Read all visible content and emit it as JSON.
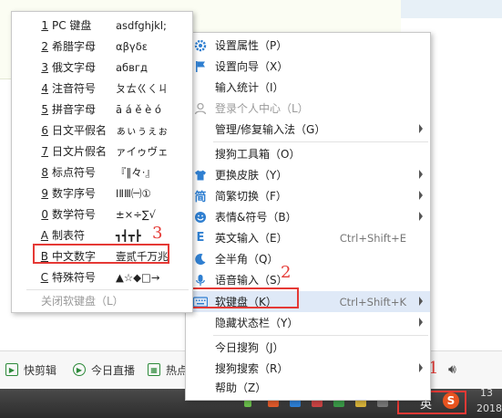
{
  "soft_keyboard_menu": {
    "items": [
      {
        "num": "1",
        "name": "PC 键盘",
        "sample": "asdfghjkl;"
      },
      {
        "num": "2",
        "name": "希腊字母",
        "sample": "αβγδε"
      },
      {
        "num": "3",
        "name": "俄文字母",
        "sample": "абвгд"
      },
      {
        "num": "4",
        "name": "注音符号",
        "sample": "ㄆㄊㄍㄑㄐ"
      },
      {
        "num": "5",
        "name": "拼音字母",
        "sample": "ā á ě è ó"
      },
      {
        "num": "6",
        "name": "日文平假名",
        "sample": "ぁぃぅぇぉ"
      },
      {
        "num": "7",
        "name": "日文片假名",
        "sample": "ァイゥヴェ"
      },
      {
        "num": "8",
        "name": "标点符号",
        "sample": "『‖々·』"
      },
      {
        "num": "9",
        "name": "数字序号",
        "sample": "ⅠⅡⅢ㈠①"
      },
      {
        "num": "0",
        "name": "数学符号",
        "sample": "±×÷∑√"
      },
      {
        "num": "A",
        "name": "制表符",
        "sample": "┓┫┳┣"
      },
      {
        "num": "B",
        "name": "中文数字",
        "sample": "壹贰千万兆"
      },
      {
        "num": "C",
        "name": "特殊符号",
        "sample": "▲☆◆□→"
      }
    ],
    "close_label": "关闭软键盘（L）"
  },
  "main_menu": {
    "items": [
      {
        "label": "设置属性（P）",
        "icon": "gear-icon",
        "color": "#2f7fd1"
      },
      {
        "label": "设置向导（X）",
        "icon": "flag-icon",
        "color": "#2f7fd1"
      },
      {
        "label": "输入统计（I）",
        "icon": "",
        "color": ""
      },
      {
        "label": "登录个人中心（L）",
        "icon": "user-icon",
        "color": "#a8a8a8"
      },
      {
        "label": "管理/修复输入法（G）",
        "icon": "",
        "color": ""
      },
      {
        "label": "搜狗工具箱（O）",
        "icon": "",
        "color": ""
      },
      {
        "label": "更换皮肤（Y）",
        "icon": "shirt-icon",
        "color": "#2f7fd1"
      },
      {
        "label": "简繁切换（F）",
        "icon": "jian-icon",
        "color": "#2f7fd1"
      },
      {
        "label": "表情&符号（B）",
        "icon": "smiley-icon",
        "color": "#2f7fd1"
      },
      {
        "label": "英文输入（E）",
        "icon": "letter-e-icon",
        "color": "#2f7fd1"
      },
      {
        "label": "全半角（Q）",
        "icon": "moon-icon",
        "color": "#2f7fd1"
      },
      {
        "label": "语音输入（S）",
        "icon": "microphone-icon",
        "color": "#2f7fd1"
      },
      {
        "label": "软键盘（K）",
        "icon": "keyboard-icon",
        "color": "#2f7fd1"
      },
      {
        "label": "隐藏状态栏（Y）",
        "icon": "",
        "color": ""
      },
      {
        "label": "今日搜狗（J）",
        "icon": "",
        "color": ""
      },
      {
        "label": "搜狗搜索（R）",
        "icon": "",
        "color": ""
      },
      {
        "label": "帮助（Z）",
        "icon": "",
        "color": ""
      }
    ],
    "shortcuts": {
      "english": "Ctrl+Shift+E",
      "soft_keyboard": "Ctrl+Shift+K"
    }
  },
  "annotations": {
    "one": "1",
    "two": "2",
    "three": "3"
  },
  "bottom_bar": {
    "items": [
      "快剪辑",
      "今日直播",
      "热点"
    ]
  },
  "tray": {
    "ime_mode": "英",
    "time_partial": "13",
    "date_partial": "2018"
  },
  "colors": {
    "accent_red": "#e53935",
    "menu_icon_blue": "#2f7fd1",
    "sogou_orange": "#e8531f"
  }
}
